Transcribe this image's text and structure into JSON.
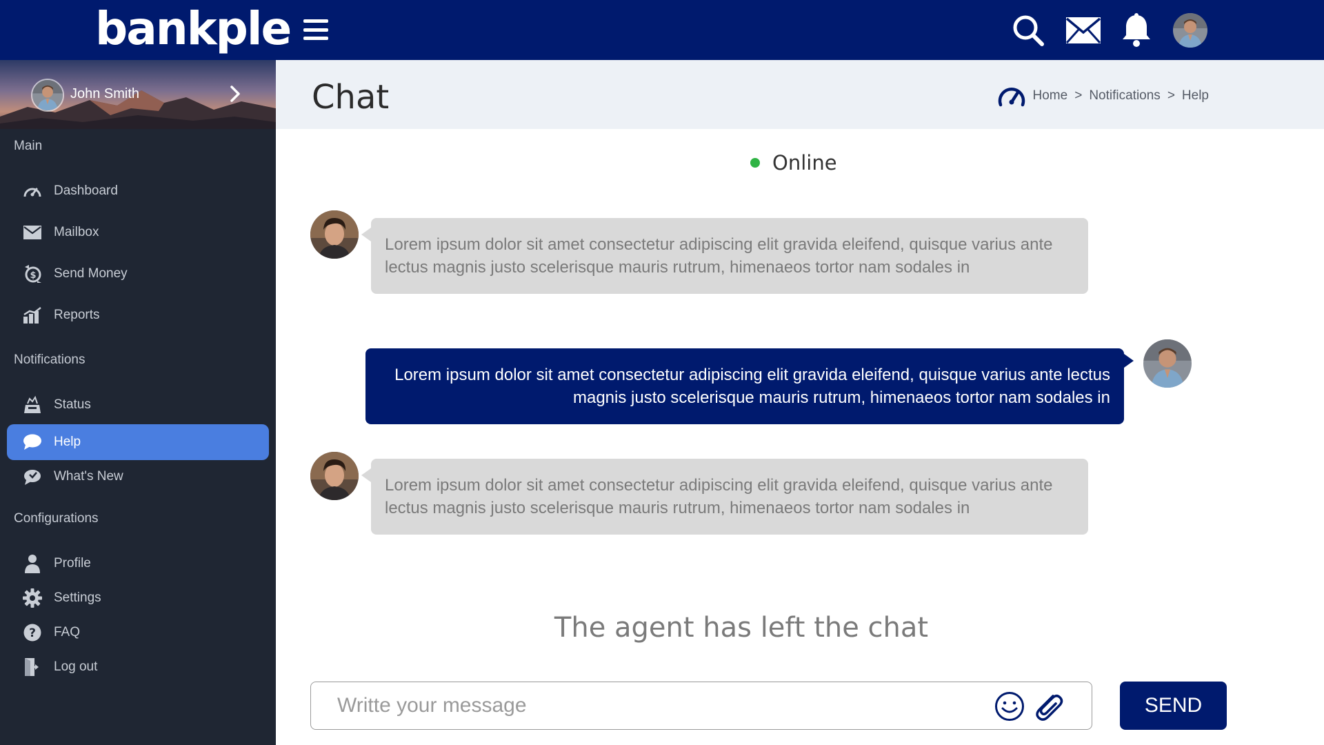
{
  "app": {
    "logo_text": "bankple"
  },
  "header": {
    "icons": [
      "menu-icon",
      "search-icon",
      "mail-icon",
      "bell-icon",
      "user-avatar"
    ]
  },
  "sidebar": {
    "user_name": "John Smith",
    "sections": {
      "main": "Main",
      "notifications": "Notifications",
      "configurations": "Configurations"
    },
    "items": [
      {
        "label": "Dashboard",
        "icon": "dashboard-icon"
      },
      {
        "label": "Mailbox",
        "icon": "mail-icon"
      },
      {
        "label": "Send Money",
        "icon": "send-money-icon"
      },
      {
        "label": "Reports",
        "icon": "reports-icon"
      },
      {
        "label": "Status",
        "icon": "status-icon"
      },
      {
        "label": "Help",
        "icon": "chat-icon",
        "active": true
      },
      {
        "label": "What's New",
        "icon": "whats-new-icon"
      },
      {
        "label": "Profile",
        "icon": "user-icon"
      },
      {
        "label": "Settings",
        "icon": "gear-icon"
      },
      {
        "label": "FAQ",
        "icon": "question-icon"
      },
      {
        "label": "Log out",
        "icon": "logout-icon"
      }
    ]
  },
  "page": {
    "title": "Chat",
    "breadcrumb": [
      "Home",
      "Notifications",
      "Help"
    ],
    "breadcrumb_separator": ">"
  },
  "chat": {
    "status": "Online",
    "status_color": "#2fb344",
    "messages": [
      {
        "from": "agent",
        "text": "Lorem ipsum dolor sit amet consectetur adipiscing elit gravida eleifend, quisque varius ante lectus magnis justo scelerisque mauris rutrum, himenaeos tortor nam sodales in"
      },
      {
        "from": "user",
        "text": "Lorem ipsum dolor sit amet consectetur adipiscing elit gravida eleifend, quisque varius ante lectus magnis justo scelerisque mauris rutrum, himenaeos tortor nam sodales in"
      },
      {
        "from": "agent",
        "text": "Lorem ipsum dolor sit amet consectetur adipiscing elit gravida eleifend, quisque varius ante lectus magnis justo scelerisque mauris rutrum, himenaeos tortor nam sodales in"
      }
    ],
    "system_note": "The agent has left the chat",
    "input": {
      "value": "",
      "placeholder": "Writte your message"
    },
    "send_label": "SEND"
  },
  "colors": {
    "brand_navy": "#001a6e",
    "sidebar_bg": "#1f2633",
    "active_item": "#4a7ee0",
    "bubble_in": "#d9d9d9"
  }
}
